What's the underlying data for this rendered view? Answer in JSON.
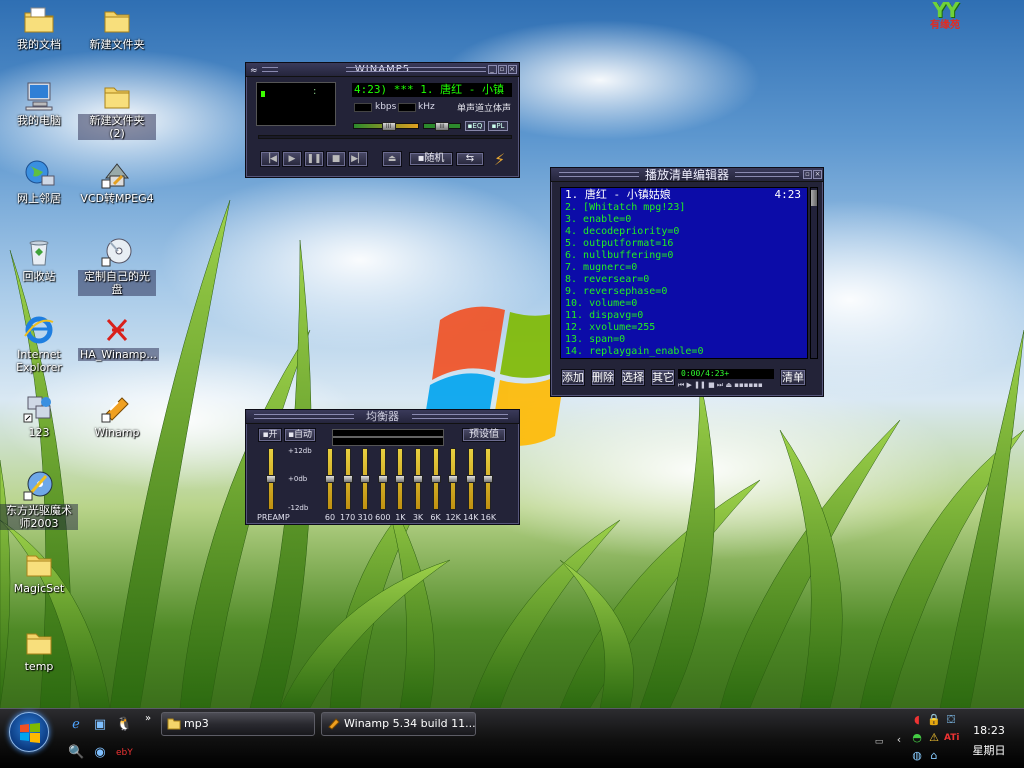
{
  "desktop": {
    "corner_logo": {
      "mark": "YY",
      "text": "有缘苑"
    },
    "icons": [
      {
        "label": "我的文档",
        "icon": "my-documents-folder-icon"
      },
      {
        "label": "新建文件夹",
        "icon": "folder-icon"
      },
      {
        "label": "我的电脑",
        "icon": "my-computer-icon"
      },
      {
        "label": "新建文件夹 (2)",
        "icon": "folder-icon"
      },
      {
        "label": "网上邻居",
        "icon": "network-places-icon"
      },
      {
        "label": "VCD转MPEG4",
        "icon": "vcd-converter-shortcut-icon"
      },
      {
        "label": "回收站",
        "icon": "recycle-bin-icon"
      },
      {
        "label": "定制自己的光盘",
        "icon": "cd-burner-shortcut-icon"
      },
      {
        "label": "Internet Explorer",
        "icon": "internet-explorer-icon"
      },
      {
        "label": "HA_Winamp...",
        "icon": "winamp-skin-file-icon"
      },
      {
        "label": "123",
        "icon": "network-shortcut-icon"
      },
      {
        "label": "Winamp",
        "icon": "winamp-shortcut-icon"
      },
      {
        "label": "东方光驱魔术师2003",
        "icon": "cd-magician-shortcut-icon"
      },
      {
        "label": "MagicSet",
        "icon": "folder-icon"
      },
      {
        "label": "temp",
        "icon": "folder-icon"
      }
    ]
  },
  "winamp_main": {
    "title": "WINAMP5",
    "song_display": "4:23)  ***  1. 唐红 - 小镇",
    "bitrate": "",
    "kbps_label": "kbps",
    "samplerate": "",
    "khz_label": "kHz",
    "stereo_label": "单声道立体声",
    "eq_button": "EQ",
    "pl_button": "PL",
    "volume_level": 0.55,
    "balance_level": 0.5,
    "transport": [
      "prev-icon",
      "play-icon",
      "pause-icon",
      "stop-icon",
      "next-icon"
    ],
    "eject_icon": "eject-icon",
    "shuffle_label": "随机",
    "repeat_icon": "repeat-icon"
  },
  "equalizer": {
    "title": "均衡器",
    "on_label": "开",
    "auto_label": "自动",
    "presets_label": "预设值",
    "db_labels": [
      "+12db",
      "+0db",
      "-12db"
    ],
    "preamp_label": "PREAMP",
    "bands": [
      "60",
      "170",
      "310",
      "600",
      "1K",
      "3K",
      "6K",
      "12K",
      "14K",
      "16K"
    ]
  },
  "playlist": {
    "title": "播放清单编辑器",
    "current": {
      "index": "1.",
      "title": "唐红 - 小镇姑娘",
      "duration": "4:23"
    },
    "items": [
      "2. [Whitatch mpg!23]",
      "3. enable=0",
      "4. decodepriority=0",
      "5. outputformat=16",
      "6. nullbuffering=0",
      "7. mugnerc=0",
      "8. reversear=0",
      "9. reversephase=0",
      "10. volume=0",
      "11. dispavg=0",
      "12. xvolume=255",
      "13. span=0",
      "14. replaygain_enable=0"
    ],
    "buttons": [
      "添加",
      "删除",
      "选择",
      "其它"
    ],
    "time_display": "0:00/4:23+",
    "clear_label": "清单"
  },
  "taskbar": {
    "start_icon": "windows-start-orb-icon",
    "quick_launch": [
      "internet-explorer-icon",
      "show-desktop-icon",
      "qq-icon",
      "search-icon",
      "media-player-icon",
      "ebay-icon"
    ],
    "tasks": [
      {
        "label": "mp3",
        "icon": "folder-icon"
      },
      {
        "label": "Winamp 5.34 build 11...",
        "icon": "winamp-icon"
      }
    ],
    "tray_icons": [
      "volume-icon",
      "lock-icon",
      "network-icon",
      "shield-icon",
      "warning-icon",
      "ati-icon",
      "globe-icon",
      "keyboard-icon"
    ],
    "time": "18:23",
    "day": "星期日"
  }
}
